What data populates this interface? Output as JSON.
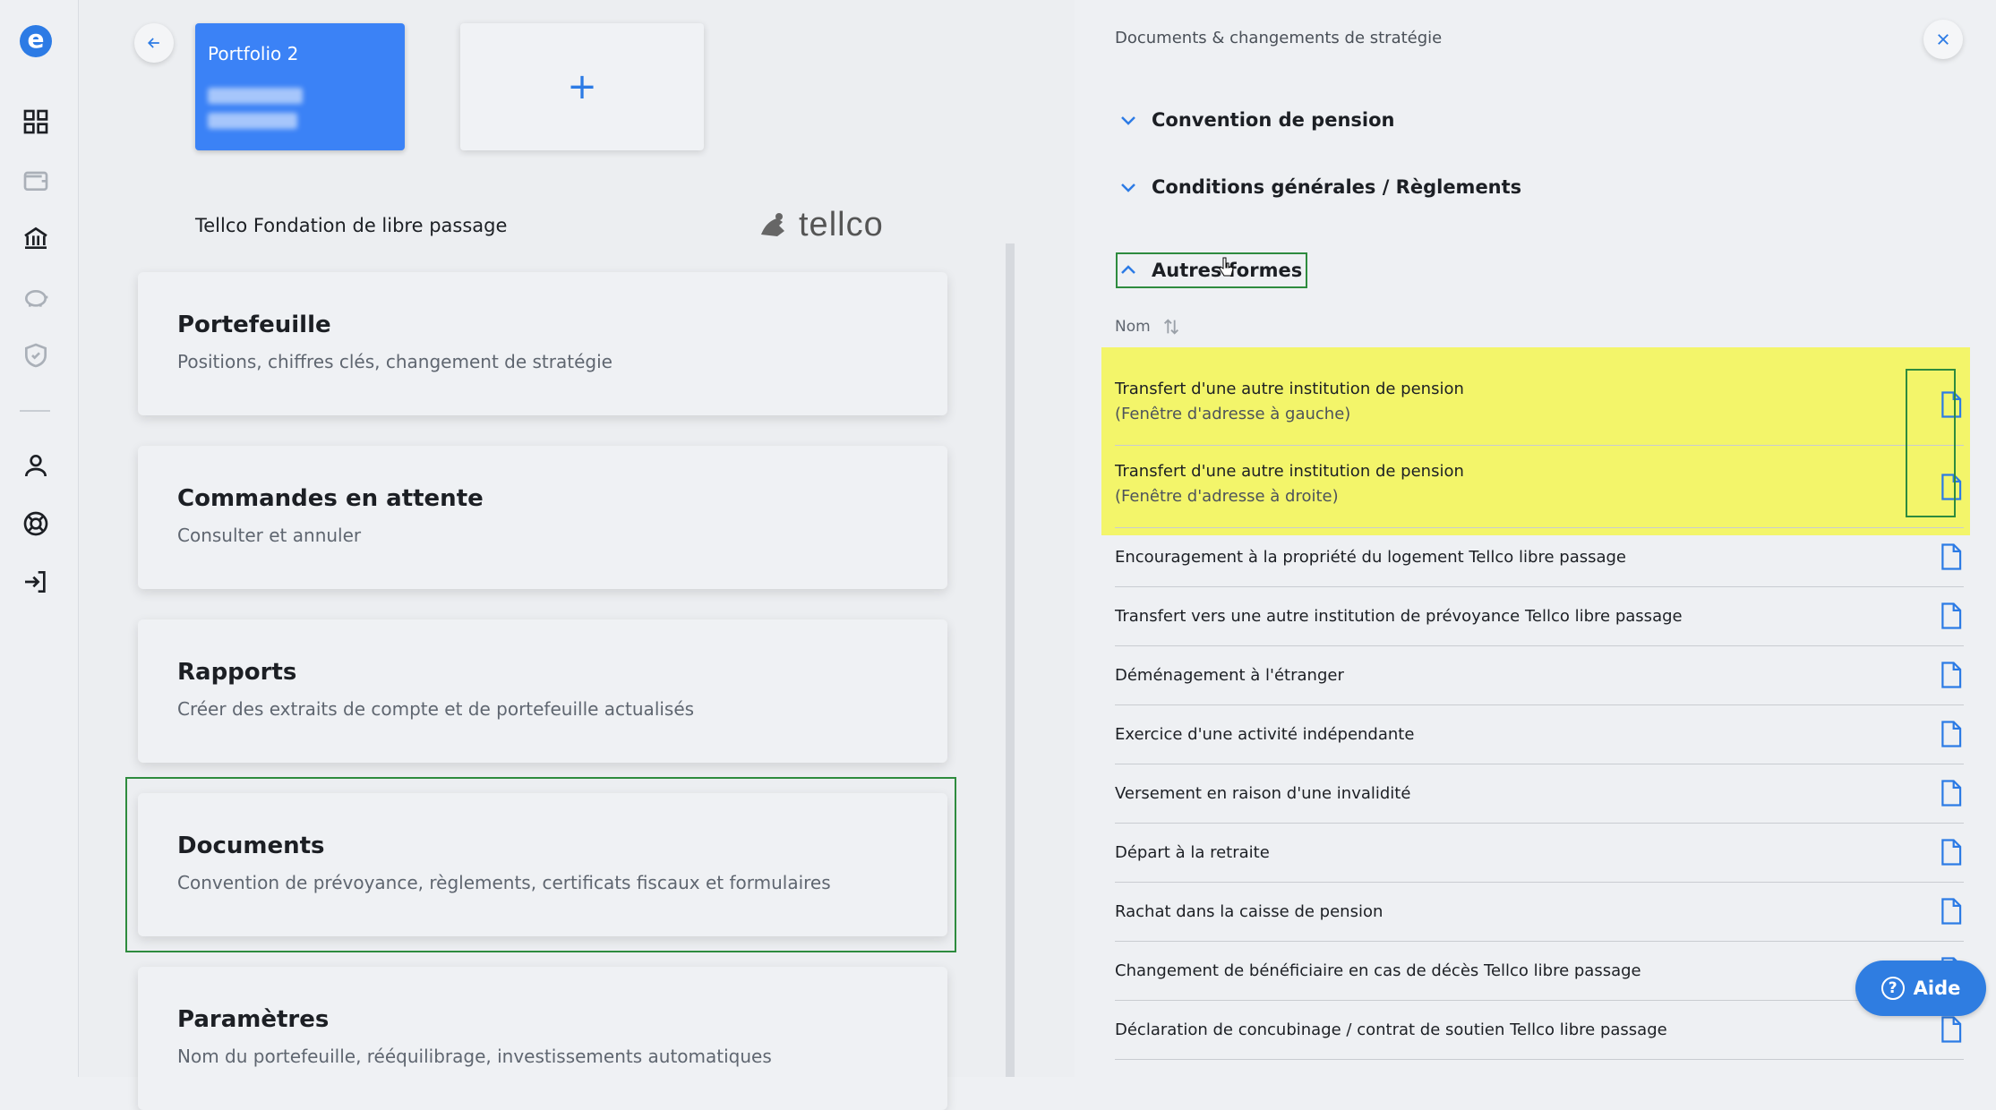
{
  "portfolio": {
    "name": "Portfolio 2",
    "add_label": "+"
  },
  "provider": {
    "name": "Tellco Fondation de libre passage",
    "logo_text": "tellco"
  },
  "menu": [
    {
      "title": "Portefeuille",
      "subtitle": "Positions, chiffres clés, changement de stratégie"
    },
    {
      "title": "Commandes en attente",
      "subtitle": "Consulter et annuler"
    },
    {
      "title": "Rapports",
      "subtitle": "Créer des extraits de compte et de portefeuille actualisés"
    },
    {
      "title": "Documents",
      "subtitle": "Convention de prévoyance, règlements, certificats fiscaux et formulaires"
    },
    {
      "title": "Paramètres",
      "subtitle": "Nom du portefeuille, rééquilibrage, investissements automatiques"
    }
  ],
  "panel": {
    "title": "Documents & changements de stratégie",
    "sections": [
      {
        "label": "Convention de pension"
      },
      {
        "label": "Conditions générales / Règlements"
      },
      {
        "label": "Autres formes"
      }
    ],
    "column_header": "Nom",
    "documents": [
      {
        "title": "Transfert d'une autre institution de pension",
        "subtitle": "(Fenêtre d'adresse à gauche)"
      },
      {
        "title": "Transfert d'une autre institution de pension",
        "subtitle": "(Fenêtre d'adresse à droite)"
      },
      {
        "title": "Encouragement à la propriété du logement Tellco libre passage"
      },
      {
        "title": "Transfert vers une autre institution de prévoyance Tellco libre passage"
      },
      {
        "title": "Déménagement à l'étranger"
      },
      {
        "title": "Exercice d'une activité indépendante"
      },
      {
        "title": "Versement en raison d'une invalidité"
      },
      {
        "title": "Départ à la retraite"
      },
      {
        "title": "Rachat dans la caisse de pension"
      },
      {
        "title": "Changement de bénéficiaire en cas de décès Tellco libre passage"
      },
      {
        "title": "Déclaration de concubinage / contrat de soutien Tellco libre passage"
      }
    ]
  },
  "help": {
    "label": "Aide"
  },
  "colors": {
    "accent": "#2c7be5",
    "highlight": "#f3f56a",
    "outline": "#2e8b3e"
  }
}
